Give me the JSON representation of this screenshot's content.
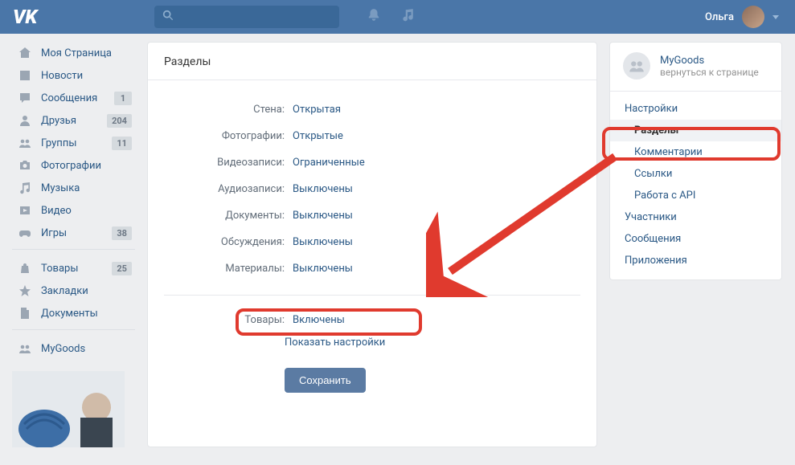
{
  "header": {
    "username": "Ольга"
  },
  "sidebar": {
    "items": [
      {
        "icon": "home",
        "label": "Моя Страница"
      },
      {
        "icon": "news",
        "label": "Новости"
      },
      {
        "icon": "chat",
        "label": "Сообщения",
        "badge": "1"
      },
      {
        "icon": "user",
        "label": "Друзья",
        "badge": "204"
      },
      {
        "icon": "group",
        "label": "Группы",
        "badge": "11"
      },
      {
        "icon": "camera",
        "label": "Фотографии"
      },
      {
        "icon": "music",
        "label": "Музыка"
      },
      {
        "icon": "video",
        "label": "Видео"
      },
      {
        "icon": "game",
        "label": "Игры",
        "badge": "38"
      }
    ],
    "items2": [
      {
        "icon": "bag",
        "label": "Товары",
        "badge": "25"
      },
      {
        "icon": "star",
        "label": "Закладки"
      },
      {
        "icon": "doc",
        "label": "Документы"
      }
    ],
    "items3": [
      {
        "icon": "group",
        "label": "MyGoods"
      }
    ]
  },
  "content": {
    "title": "Разделы",
    "settings": [
      {
        "label": "Стена:",
        "value": "Открытая"
      },
      {
        "label": "Фотографии:",
        "value": "Открытые"
      },
      {
        "label": "Видеозаписи:",
        "value": "Ограниченные"
      },
      {
        "label": "Аудиозаписи:",
        "value": "Выключены"
      },
      {
        "label": "Документы:",
        "value": "Выключены"
      },
      {
        "label": "Обсуждения:",
        "value": "Выключены"
      },
      {
        "label": "Материалы:",
        "value": "Выключены"
      }
    ],
    "products": {
      "label": "Товары:",
      "value": "Включены"
    },
    "show_settings": "Показать настройки",
    "save": "Сохранить"
  },
  "rightcol": {
    "group_name": "MyGoods",
    "group_sub": "вернуться к странице",
    "menu": [
      {
        "label": "Настройки",
        "indent": false
      },
      {
        "label": "Разделы",
        "indent": true,
        "selected": true
      },
      {
        "label": "Комментарии",
        "indent": true
      },
      {
        "label": "Ссылки",
        "indent": true
      },
      {
        "label": "Работа с API",
        "indent": true
      },
      {
        "label": "Участники",
        "indent": false
      },
      {
        "label": "Сообщения",
        "indent": false
      },
      {
        "label": "Приложения",
        "indent": false
      }
    ]
  }
}
